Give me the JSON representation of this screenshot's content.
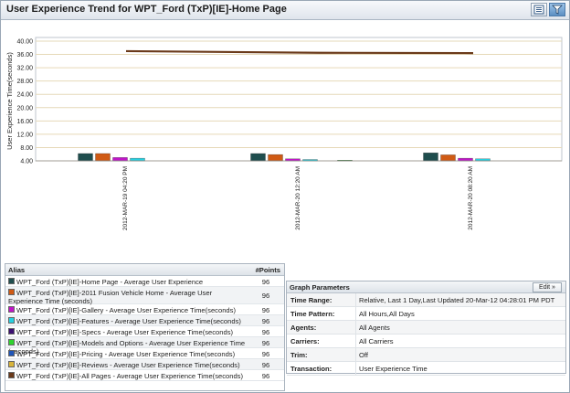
{
  "window": {
    "title": "User Experience Trend for WPT_Ford (TxP)[IE]-Home Page"
  },
  "toolbar": {
    "icons": [
      "list-icon",
      "filter-icon"
    ]
  },
  "chart_data": {
    "type": "bar",
    "ylabel": "User Experience Time(seconds)",
    "ylim": [
      4.0,
      40.0
    ],
    "yticks": [
      "40.00",
      "36.00",
      "32.00",
      "28.00",
      "24.00",
      "20.00",
      "16.00",
      "12.00",
      "8.00",
      "4.00"
    ],
    "categories": [
      "2012-MAR-19 04:20 PM",
      "2012-MAR-20 12:20 AM",
      "2012-MAR-20 08:20 AM"
    ],
    "series": [
      {
        "name": "WPT_Ford (TxP)[IE]-Home Page - Average User Experience Time(seconds)",
        "color": "#1f4e4e",
        "values": [
          6.2,
          6.2,
          6.4
        ]
      },
      {
        "name": "WPT_Ford (TxP)[IE]-2011 Fusion Vehicle Home - Average User Experience Time (seconds)",
        "color": "#d05a14",
        "values": [
          6.2,
          5.9,
          5.8
        ]
      },
      {
        "name": "WPT_Ford (TxP)[IE]-Gallery - Average User Experience Time(seconds)",
        "color": "#c016c8",
        "values": [
          5.0,
          4.6,
          4.8
        ]
      },
      {
        "name": "WPT_Ford (TxP)[IE]-Features - Average User Experience Time(seconds)",
        "color": "#27d0e0",
        "values": [
          4.8,
          4.4,
          4.6
        ]
      },
      {
        "name": "WPT_Ford (TxP)[IE]-Specs - Average User Experience Time(seconds)",
        "color": "#3b0f72",
        "values": [
          3.8,
          3.7,
          3.5
        ]
      },
      {
        "name": "WPT_Ford (TxP)[IE]-Models and Options - Average User Experience Time (seconds)",
        "color": "#2ed42e",
        "values": [
          4.0,
          4.2,
          3.9
        ]
      },
      {
        "name": "WPT_Ford (TxP)[IE]-Pricing - Average User Experience Time(seconds)",
        "color": "#1f55b8",
        "values": [
          3.9,
          3.9,
          3.9
        ]
      },
      {
        "name": "WPT_Ford (TxP)[IE]-Reviews - Average User Experience Time(seconds)",
        "color": "#d8b43a",
        "values": [
          3.6,
          3.6,
          3.8
        ]
      }
    ],
    "line_series": {
      "name": "WPT_Ford (TxP)[IE]-All Pages - Average User Experience Time(seconds)",
      "color": "#6b3a1a",
      "values": [
        37.0,
        36.5,
        36.4
      ]
    },
    "grid": true
  },
  "alias_table": {
    "headers": {
      "alias": "Alias",
      "points": "#Points"
    },
    "rows": [
      {
        "label": "WPT_Ford (TxP)[IE]-Home Page - Average User Experience Time(seconds)",
        "points": "96",
        "color": "#1f4e4e"
      },
      {
        "label": "WPT_Ford (TxP)[IE]-2011 Fusion Vehicle Home - Average User Experience Time (seconds)",
        "points": "96",
        "color": "#d05a14"
      },
      {
        "label": "WPT_Ford (TxP)[IE]-Gallery - Average User Experience Time(seconds)",
        "points": "96",
        "color": "#c016c8"
      },
      {
        "label": "WPT_Ford (TxP)[IE]-Features - Average User Experience Time(seconds)",
        "points": "96",
        "color": "#27d0e0"
      },
      {
        "label": "WPT_Ford (TxP)[IE]-Specs - Average User Experience Time(seconds)",
        "points": "96",
        "color": "#3b0f72"
      },
      {
        "label": "WPT_Ford (TxP)[IE]-Models and Options - Average User Experience Time (seconds)",
        "points": "96",
        "color": "#2ed42e"
      },
      {
        "label": "WPT_Ford (TxP)[IE]-Pricing - Average User Experience Time(seconds)",
        "points": "96",
        "color": "#1f55b8"
      },
      {
        "label": "WPT_Ford (TxP)[IE]-Reviews - Average User Experience Time(seconds)",
        "points": "96",
        "color": "#d8b43a"
      },
      {
        "label": "WPT_Ford (TxP)[IE]-All Pages - Average User Experience Time(seconds)",
        "points": "96",
        "color": "#6b3a1a"
      }
    ]
  },
  "graph_parameters": {
    "title": "Graph Parameters",
    "edit_label": "Edit »",
    "rows": [
      {
        "key": "Time Range:",
        "value": "Relative, Last 1 Day,Last Updated 20-Mar-12 04:28:01 PM PDT"
      },
      {
        "key": "Time Pattern:",
        "value": "All Hours,All Days"
      },
      {
        "key": "Agents:",
        "value": "All Agents"
      },
      {
        "key": "Carriers:",
        "value": "All Carriers"
      },
      {
        "key": "Trim:",
        "value": "Off"
      },
      {
        "key": "Transaction:",
        "value": "User Experience Time"
      }
    ]
  }
}
